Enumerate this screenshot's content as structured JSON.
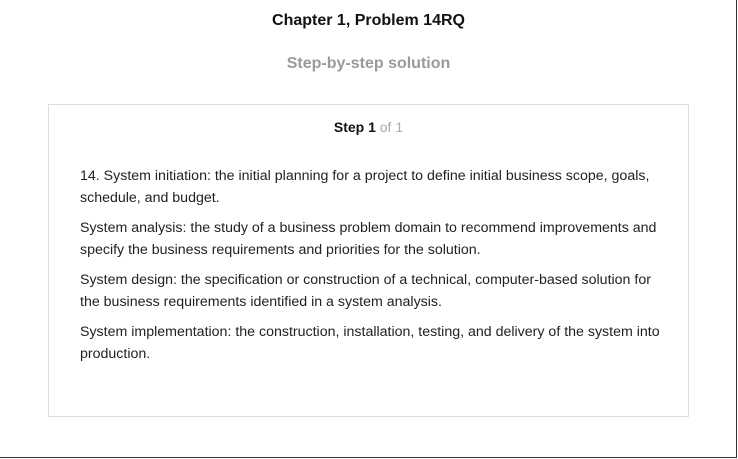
{
  "header": {
    "title": "Chapter 1, Problem 14RQ",
    "subtitle": "Step-by-step solution"
  },
  "step": {
    "label": "Step 1",
    "total": "of 1"
  },
  "paragraphs": [
    "14. System initiation: the initial planning for a project to define initial business scope, goals, schedule, and budget.",
    "System analysis: the study of a business problem domain to recommend improvements and specify the business requirements and priorities for the solution.",
    "System design: the specification or construction of a technical, computer-based solution for the business requirements identified in a system analysis.",
    "System implementation: the construction, installation, testing, and delivery of the system into production."
  ]
}
